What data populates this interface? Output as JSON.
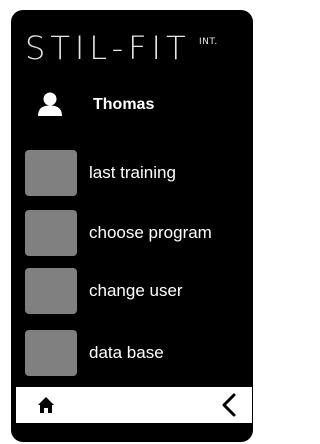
{
  "brand": {
    "name": "STIL-FIT",
    "suffix": "INT."
  },
  "user": {
    "icon": "user-icon",
    "name": "Thomas"
  },
  "menu": {
    "items": [
      {
        "label": "last training"
      },
      {
        "label": "choose program"
      },
      {
        "label": "change user"
      },
      {
        "label": "data base"
      }
    ]
  },
  "bottom_bar": {
    "home_icon": "home-icon",
    "back_icon": "chevron-left-icon"
  },
  "colors": {
    "screen_bg": "#000000",
    "tile": "#808080",
    "text": "#ffffff",
    "bar_bg": "#ffffff"
  }
}
